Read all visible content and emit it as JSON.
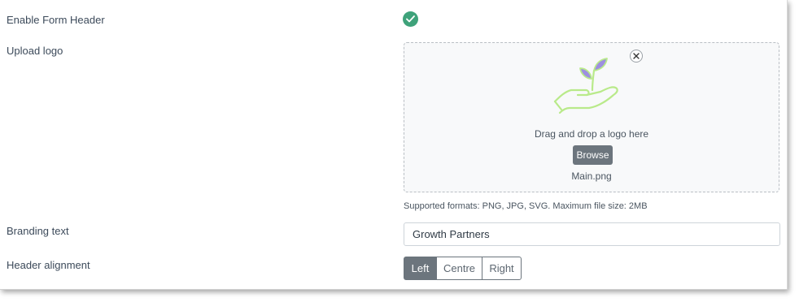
{
  "form": {
    "enable_header_label": "Enable Form Header",
    "upload_logo_label": "Upload logo",
    "branding_text_label": "Branding text",
    "header_alignment_label": "Header alignment"
  },
  "upload": {
    "drop_text": "Drag and drop a logo here",
    "browse_label": "Browse",
    "file_name": "Main.png",
    "hint": "Supported formats: PNG, JPG, SVG. Maximum file size: 2MB",
    "plant_icon": "plant-in-hand-icon"
  },
  "branding": {
    "value": "Growth Partners"
  },
  "alignment": {
    "options": [
      "Left",
      "Centre",
      "Right"
    ],
    "selected": "Left"
  },
  "colors": {
    "check_green": "#3ea27a",
    "button_gray": "#6c757d",
    "plant_leaf_purple": "#9d8fe0",
    "plant_outline_green": "#b9ea8a"
  }
}
